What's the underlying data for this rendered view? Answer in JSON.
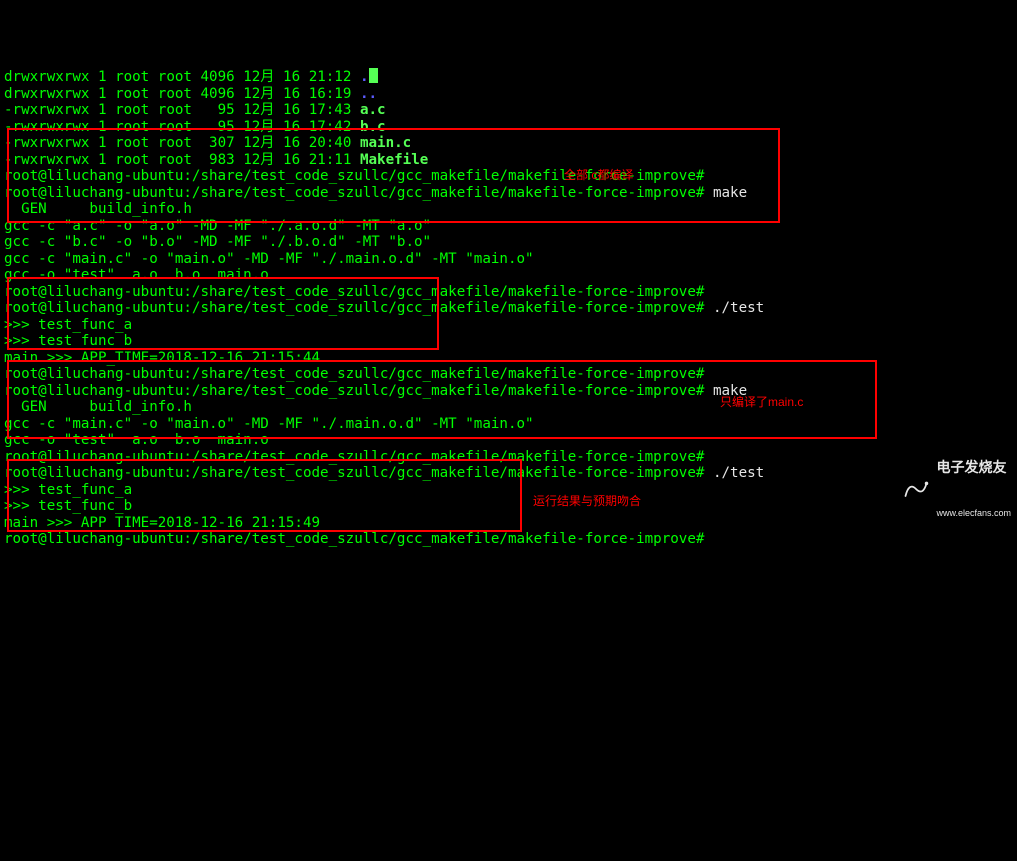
{
  "perm_dir": "drwxrwxrwx",
  "perm_exe": "-rwxrwxrwx",
  "link": "1",
  "owner": "root",
  "group": "root",
  "sz4096": "4096",
  "sz95": "95",
  "sz307": "307",
  "sz983": "983",
  "mon": "12月",
  "day": "16",
  "t2112": "21:12",
  "t1619": "16:19",
  "t1743": "17:43",
  "t1742": "17:42",
  "t2040": "20:40",
  "t2111": "21:11",
  "dot": ".",
  "dotdot": "..",
  "fn_ac": "a.c",
  "fn_bc": "b.c",
  "fn_mainc": "main.c",
  "fn_make": "Makefile",
  "prompt": "root@liluchang-ubuntu:/share/test_code_szullc/gcc_makefile/makefile-force-improve#",
  "cmd_make": "make",
  "cmd_test": "./test",
  "gen_line": "  GEN     build_info.h",
  "gcc_a": "gcc -c \"a.c\" -o \"a.o\" -MD -MF \"./.a.o.d\" -MT \"a.o\"",
  "gcc_b": "gcc -c \"b.c\" -o \"b.o\" -MD -MF \"./.b.o.d\" -MT \"b.o\"",
  "gcc_main": "gcc -c \"main.c\" -o \"main.o\" -MD -MF \"./.main.o.d\" -MT \"main.o\"",
  "gcc_link": "gcc -o \"test\"  a.o  b.o  main.o",
  "out_a": ">>> test_func_a",
  "out_b": ">>> test_func_b",
  "out_time1": "main >>> APP_TIME=2018-12-16 21:15:44",
  "out_time2": "main >>> APP_TIME=2018-12-16 21:15:49",
  "anno_all": "全部.c都编译",
  "anno_only": "只编译了main.c",
  "anno_result": "运行结果与预期吻合",
  "wm_cn": "电子发烧友",
  "wm_en": "www.elecfans.com"
}
